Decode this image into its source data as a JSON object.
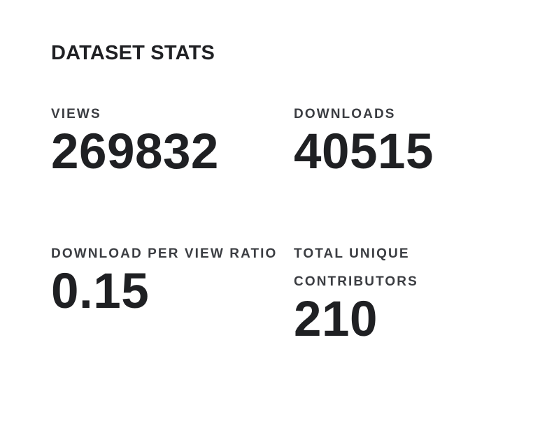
{
  "panel": {
    "title": "DATASET STATS"
  },
  "stats": {
    "views": {
      "label": "VIEWS",
      "value": "269832"
    },
    "downloads": {
      "label": "DOWNLOADS",
      "value": "40515"
    },
    "ratio": {
      "label": "DOWNLOAD PER VIEW RATIO",
      "value": "0.15"
    },
    "contributors": {
      "label": "TOTAL UNIQUE CONTRIBUTORS",
      "value": "210"
    }
  },
  "colors": {
    "background": "#ffffff",
    "value_text": "#1f2023",
    "label_text": "#3b3d42"
  }
}
